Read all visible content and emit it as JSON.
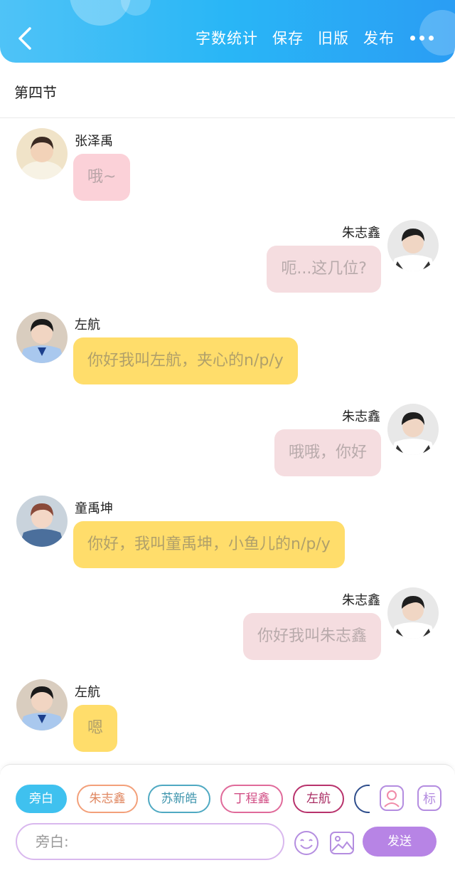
{
  "header": {
    "actions": [
      "字数统计",
      "保存",
      "旧版",
      "发布"
    ]
  },
  "section": {
    "title": "第四节"
  },
  "messages": [
    {
      "side": "left",
      "sender": "张泽禹",
      "text": "哦~",
      "style": "pink"
    },
    {
      "side": "right",
      "sender": "朱志鑫",
      "text": "呃...这几位?",
      "style": "lightpink"
    },
    {
      "side": "left",
      "sender": "左航",
      "text": "你好我叫左航，夹心的n/p/y",
      "style": "yellow"
    },
    {
      "side": "right",
      "sender": "朱志鑫",
      "text": "哦哦，你好",
      "style": "lightpink"
    },
    {
      "side": "left",
      "sender": "童禹坤",
      "text": "你好，我叫童禹坤，小鱼儿的n/p/y",
      "style": "yellow"
    },
    {
      "side": "right",
      "sender": "朱志鑫",
      "text": "你好我叫朱志鑫",
      "style": "lightpink"
    },
    {
      "side": "left",
      "sender": "左航",
      "text": "嗯",
      "style": "yellow"
    }
  ],
  "composer": {
    "roles": [
      "旁白",
      "朱志鑫",
      "苏新皓",
      "丁程鑫",
      "左航",
      ""
    ],
    "active_role": "旁白",
    "tag_icon_label": "标",
    "input_value": "旁白:",
    "send_label": "发送"
  },
  "colors": {
    "header_gradient_start": "#4fc3f7",
    "header_gradient_end": "#2a9df4",
    "bubble_pink": "#fbd1d8",
    "bubble_lightpink": "#f5dde0",
    "bubble_yellow": "#ffdd6b",
    "send_button": "#b784e5",
    "active_chip": "#3fc1ef"
  }
}
